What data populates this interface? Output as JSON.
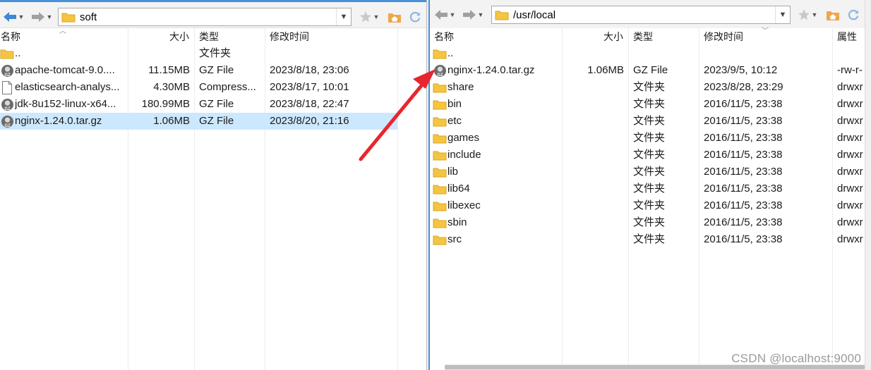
{
  "left_pane": {
    "path": "soft",
    "columns": {
      "name": "名称",
      "size": "大小",
      "type": "类型",
      "modified": "修改时间"
    },
    "rows": [
      {
        "icon": "folder-icon",
        "name": "..",
        "size": "",
        "type": "文件夹",
        "modified": ""
      },
      {
        "icon": "gz-file-icon",
        "name": "apache-tomcat-9.0....",
        "size": "11.15MB",
        "type": "GZ File",
        "modified": "2023/8/18, 23:06"
      },
      {
        "icon": "document-icon",
        "name": "elasticsearch-analys...",
        "size": "4.30MB",
        "type": "Compress...",
        "modified": "2023/8/17, 10:01"
      },
      {
        "icon": "gz-file-icon",
        "name": "jdk-8u152-linux-x64...",
        "size": "180.99MB",
        "type": "GZ File",
        "modified": "2023/8/18, 22:47"
      },
      {
        "icon": "gz-file-icon",
        "name": "nginx-1.24.0.tar.gz",
        "size": "1.06MB",
        "type": "GZ File",
        "modified": "2023/8/20, 21:16",
        "selected": true
      }
    ]
  },
  "right_pane": {
    "path": "/usr/local",
    "columns": {
      "name": "名称",
      "size": "大小",
      "type": "类型",
      "modified": "修改时间",
      "attributes": "属性"
    },
    "rows": [
      {
        "icon": "folder-icon",
        "name": "..",
        "size": "",
        "type": "",
        "modified": "",
        "attributes": ""
      },
      {
        "icon": "gz-file-icon",
        "name": "nginx-1.24.0.tar.gz",
        "size": "1.06MB",
        "type": "GZ File",
        "modified": "2023/9/5, 10:12",
        "attributes": "-rw-r-"
      },
      {
        "icon": "folder-icon",
        "name": "share",
        "size": "",
        "type": "文件夹",
        "modified": "2023/8/28, 23:29",
        "attributes": "drwxr"
      },
      {
        "icon": "folder-icon",
        "name": "bin",
        "size": "",
        "type": "文件夹",
        "modified": "2016/11/5, 23:38",
        "attributes": "drwxr"
      },
      {
        "icon": "folder-icon",
        "name": "etc",
        "size": "",
        "type": "文件夹",
        "modified": "2016/11/5, 23:38",
        "attributes": "drwxr"
      },
      {
        "icon": "folder-icon",
        "name": "games",
        "size": "",
        "type": "文件夹",
        "modified": "2016/11/5, 23:38",
        "attributes": "drwxr"
      },
      {
        "icon": "folder-icon",
        "name": "include",
        "size": "",
        "type": "文件夹",
        "modified": "2016/11/5, 23:38",
        "attributes": "drwxr"
      },
      {
        "icon": "folder-icon",
        "name": "lib",
        "size": "",
        "type": "文件夹",
        "modified": "2016/11/5, 23:38",
        "attributes": "drwxr"
      },
      {
        "icon": "folder-icon",
        "name": "lib64",
        "size": "",
        "type": "文件夹",
        "modified": "2016/11/5, 23:38",
        "attributes": "drwxr"
      },
      {
        "icon": "folder-icon",
        "name": "libexec",
        "size": "",
        "type": "文件夹",
        "modified": "2016/11/5, 23:38",
        "attributes": "drwxr"
      },
      {
        "icon": "folder-icon",
        "name": "sbin",
        "size": "",
        "type": "文件夹",
        "modified": "2016/11/5, 23:38",
        "attributes": "drwxr"
      },
      {
        "icon": "folder-icon",
        "name": "src",
        "size": "",
        "type": "文件夹",
        "modified": "2016/11/5, 23:38",
        "attributes": "drwxr"
      }
    ]
  },
  "toolbar_icons": [
    "back-arrow-icon",
    "forward-arrow-icon",
    "favorite-star-icon",
    "home-folder-icon",
    "refresh-icon"
  ],
  "annotation": {
    "arrow_color": "#e8262d"
  },
  "colors": {
    "selection": "#cce8ff",
    "folder": "#f5c542",
    "accent": "#4a90d9"
  },
  "watermark": "CSDN @localhost:9000"
}
